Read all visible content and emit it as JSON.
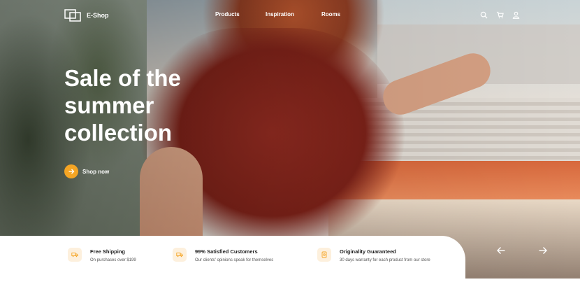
{
  "brand": {
    "name": "E-Shop",
    "icon": "logo-icon"
  },
  "nav": {
    "items": [
      {
        "label": "Products"
      },
      {
        "label": "Inspiration"
      },
      {
        "label": "Rooms"
      }
    ]
  },
  "header_icons": [
    "search-icon",
    "cart-icon",
    "user-icon"
  ],
  "hero": {
    "headline_lines": [
      "Sale of the",
      "summer",
      "collection"
    ],
    "cta_label": "Shop now",
    "cta_icon": "arrow-right-icon"
  },
  "features": [
    {
      "icon": "truck-icon",
      "title": "Free Shipping",
      "subtitle": "On purchases over $199"
    },
    {
      "icon": "truck-icon",
      "title": "99% Satisfied Customers",
      "subtitle": "Our clients' opinions speak for themselves"
    },
    {
      "icon": "badge-icon",
      "title": "Originality Guaranteed",
      "subtitle": "30 days warranty for each product from our store"
    }
  ],
  "slider": {
    "prev_icon": "arrow-left-icon",
    "next_icon": "arrow-right-icon"
  },
  "colors": {
    "accent": "#f5a524",
    "feature_icon_bg": "#fdf0dd",
    "text_dark": "#1d1d1d"
  }
}
